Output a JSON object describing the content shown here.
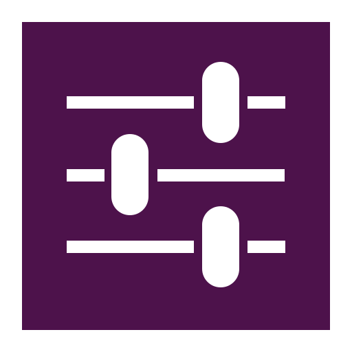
{
  "icon": {
    "name": "sliders-icon",
    "colors": {
      "background": "#4d124b",
      "foreground": "#ffffff",
      "page": "#ffffff"
    }
  },
  "sliders": [
    {
      "name": "slider-1",
      "value": 0.67
    },
    {
      "name": "slider-2",
      "value": 0.29
    },
    {
      "name": "slider-3",
      "value": 0.67
    }
  ]
}
